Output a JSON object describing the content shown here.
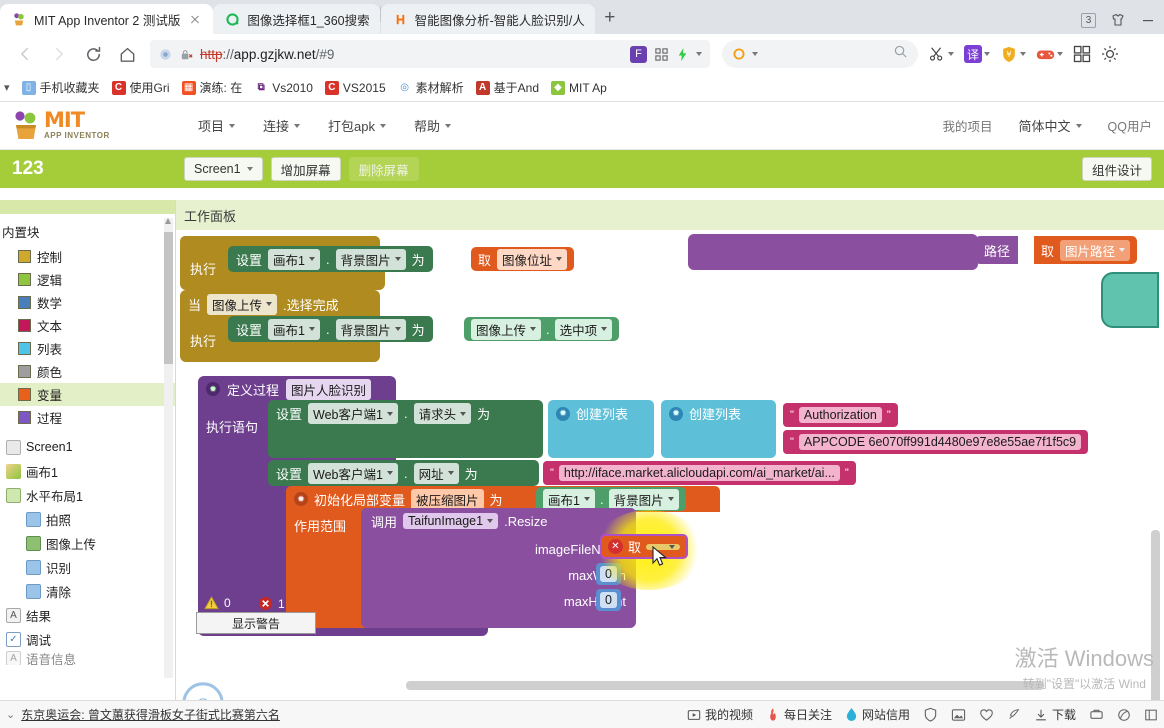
{
  "browser": {
    "tabs": [
      {
        "title": "MIT App Inventor 2 测试版",
        "active": true,
        "favicon": "appinventor-icon",
        "closable": true
      },
      {
        "title": "图像选择框1_360搜索",
        "active": false,
        "favicon": "360-search-icon",
        "closable": false
      },
      {
        "title": "智能图像分析-智能人脸识别/人",
        "active": false,
        "favicon": "aliyun-icon",
        "closable": false
      }
    ],
    "new_tab_label": "+",
    "window_badge_count": "3",
    "nav": {
      "back_icon": "back-arrow-icon",
      "forward_icon": "forward-arrow-icon",
      "reload_icon": "reload-icon",
      "home_icon": "home-icon"
    },
    "omnibox": {
      "scheme": "http",
      "separator": "://",
      "host": "app.gzjkw.net",
      "path": "/#9",
      "security_icon": "insecure-lock-icon",
      "page_icon": "page-icon",
      "right_icons": [
        "fanyi-badge-icon",
        "qrcode-icon",
        "lightning-icon",
        "chevron-down-icon"
      ]
    },
    "search": {
      "placeholder": "",
      "engine_icon": "360-circle-icon",
      "search_icon": "search-icon"
    },
    "toolbar_icons": [
      "scissors-icon",
      "translate-icon",
      "shield-icon",
      "game-icon",
      "grid-apps-icon",
      "settings-icon"
    ],
    "toolbar_labels": {
      "translate": "译",
      "shield": "¥"
    },
    "bookmarks": [
      {
        "label": "手机收藏夹",
        "icon": "phone-icon",
        "color": "#7fb2e5"
      },
      {
        "label": "使用Gri",
        "icon": "c-icon",
        "color": "#d9322a"
      },
      {
        "label": "演练: 在",
        "icon": "ms-icon",
        "color": "#f25022"
      },
      {
        "label": "Vs2010",
        "icon": "vs-icon",
        "color": "#68217a"
      },
      {
        "label": "VS2015",
        "icon": "c-icon",
        "color": "#d9322a"
      },
      {
        "label": "素材解析",
        "icon": "circle-icon",
        "color": "#4a90d9"
      },
      {
        "label": "基于And",
        "icon": "android-icon",
        "color": "#c0392b"
      },
      {
        "label": "MIT Ap",
        "icon": "appinventor-icon",
        "color": "#7fb000"
      }
    ]
  },
  "app": {
    "logo_main": "MIT",
    "logo_sub": "APP INVENTOR",
    "menus": [
      {
        "label": "项目",
        "has_caret": true
      },
      {
        "label": "连接",
        "has_caret": true
      },
      {
        "label": "打包apk",
        "has_caret": true
      },
      {
        "label": "帮助",
        "has_caret": true
      }
    ],
    "right_links": [
      {
        "label": "我的项目",
        "has_caret": false
      },
      {
        "label": "简体中文",
        "has_caret": true
      },
      {
        "label": "QQ用户",
        "has_caret": false
      }
    ],
    "project": {
      "name": "123",
      "screen_selector": "Screen1",
      "add_screen": "增加屏幕",
      "remove_screen": "删除屏幕",
      "designer_toggle": "组件设计"
    }
  },
  "sidebar": {
    "builtin_header": "内置块",
    "builtin": [
      {
        "label": "控制",
        "color": "#cfa82e",
        "selected": false
      },
      {
        "label": "逻辑",
        "color": "#8ec63f",
        "selected": false
      },
      {
        "label": "数学",
        "color": "#4a7ebb",
        "selected": false
      },
      {
        "label": "文本",
        "color": "#c2185b",
        "selected": false
      },
      {
        "label": "列表",
        "color": "#4fc3e8",
        "selected": false
      },
      {
        "label": "颜色",
        "color": "#9e9e9e",
        "selected": false
      },
      {
        "label": "变量",
        "color": "#e8601c",
        "selected": true
      },
      {
        "label": "过程",
        "color": "#7e57c2",
        "selected": false
      }
    ],
    "components": [
      {
        "label": "Screen1",
        "icon": "screen-icon",
        "indent": 0
      },
      {
        "label": "画布1",
        "icon": "canvas-icon",
        "indent": 0
      },
      {
        "label": "水平布局1",
        "icon": "hlayout-icon",
        "indent": 0
      },
      {
        "label": "拍照",
        "icon": "button-icon",
        "indent": 1
      },
      {
        "label": "图像上传",
        "icon": "imagepicker-icon",
        "indent": 1
      },
      {
        "label": "识别",
        "icon": "button-icon",
        "indent": 1
      },
      {
        "label": "清除",
        "icon": "button-icon",
        "indent": 1
      },
      {
        "label": "结果",
        "icon": "label-icon",
        "indent": 0
      },
      {
        "label": "调试",
        "icon": "checkbox-icon",
        "indent": 0
      },
      {
        "label": "语音信息",
        "icon": "label-icon",
        "indent": 0
      }
    ]
  },
  "workspace": {
    "panel_title": "工作面板",
    "warning_count": "0",
    "error_count": "1",
    "show_warnings_button": "显示警告",
    "blocks": {
      "top_event_exec": "执行",
      "set_word": "设置",
      "canvas1": "画布1",
      "background_image": "背景图片",
      "to_word": "为",
      "get_word": "取",
      "image_address": "图像位址",
      "when_word": "当",
      "image_upload": "图像上传",
      "after_picking": ".选择完成",
      "selection": "选中项",
      "path_label": "路径",
      "image_path": "图片路径",
      "define_proc": "定义过程",
      "proc_name": "图片人脸识别",
      "do_stmts": "执行语句",
      "web_client": "Web客户端1",
      "request_headers": "请求头",
      "make_list": "创建列表",
      "auth_key": "Authorization",
      "appcode_value": "APPCODE 6e070ff991d4480e97e8e55ae7f1f5c9",
      "url_prop": "网址",
      "url_value": "http://iface.market.alicloudapi.com/ai_market/ai...",
      "init_local": "初始化局部变量",
      "local_name": "被压缩图片",
      "scope_label": "作用范围",
      "call_word": "调用",
      "taifun_component": "TaifunImage1",
      "resize_method": ".Resize",
      "arg_filename": "imageFileName",
      "arg_maxwidth": "maxWidth",
      "arg_maxheight": "maxHeight",
      "zero": "0",
      "empty_socket": ""
    }
  },
  "desktop": {
    "windows_activate_title": "激活 Windows",
    "windows_activate_sub": "转到\"设置\"以激活 Wind",
    "news_ticker": "东京奥运会: 曾文蕙获得滑板女子街式比赛第六名",
    "taskbar_items": [
      {
        "label": "我的视频",
        "icon": "video-icon"
      },
      {
        "label": "每日关注",
        "icon": "flame-icon"
      },
      {
        "label": "网站信用",
        "icon": "droplet-icon"
      },
      {
        "label": "",
        "icon": "shield-icon"
      },
      {
        "label": "",
        "icon": "picture-icon"
      },
      {
        "label": "",
        "icon": "heart-icon"
      },
      {
        "label": "",
        "icon": "rocket-icon"
      },
      {
        "label": "下载",
        "icon": "download-icon"
      },
      {
        "label": "",
        "icon": "tool-icon"
      },
      {
        "label": "",
        "icon": "leaf-icon"
      },
      {
        "label": "",
        "icon": "window-icon"
      }
    ]
  }
}
